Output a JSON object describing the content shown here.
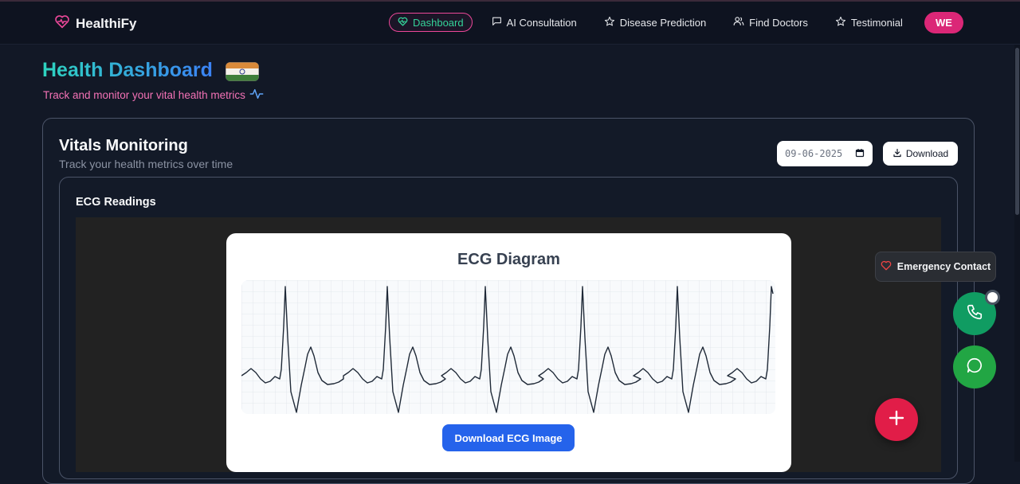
{
  "app": {
    "name": "HealthiFy"
  },
  "nav": {
    "items": [
      {
        "label": "Dashboard",
        "icon": "heart-pulse-icon",
        "active": true
      },
      {
        "label": "AI Consultation",
        "icon": "chat-icon"
      },
      {
        "label": "Disease Prediction",
        "icon": "star-icon"
      },
      {
        "label": "Find Doctors",
        "icon": "users-icon"
      },
      {
        "label": "Testimonial",
        "icon": "star-icon"
      }
    ],
    "avatar": "WE"
  },
  "header": {
    "title": "Health Dashboard",
    "subtitle": "Track and monitor your vital health metrics"
  },
  "vitals": {
    "title": "Vitals Monitoring",
    "subtitle": "Track your health metrics over time",
    "date_value": "09-06-2025",
    "download_label": "Download"
  },
  "ecg": {
    "section_title": "ECG Readings",
    "diagram_title": "ECG Diagram",
    "download_label": "Download ECG Image"
  },
  "floating": {
    "emergency_label": "Emergency Contact"
  },
  "colors": {
    "accent_pink": "#ec4899",
    "accent_green": "#34d399",
    "primary_blue": "#2563eb",
    "fab_red": "#e11d48"
  }
}
